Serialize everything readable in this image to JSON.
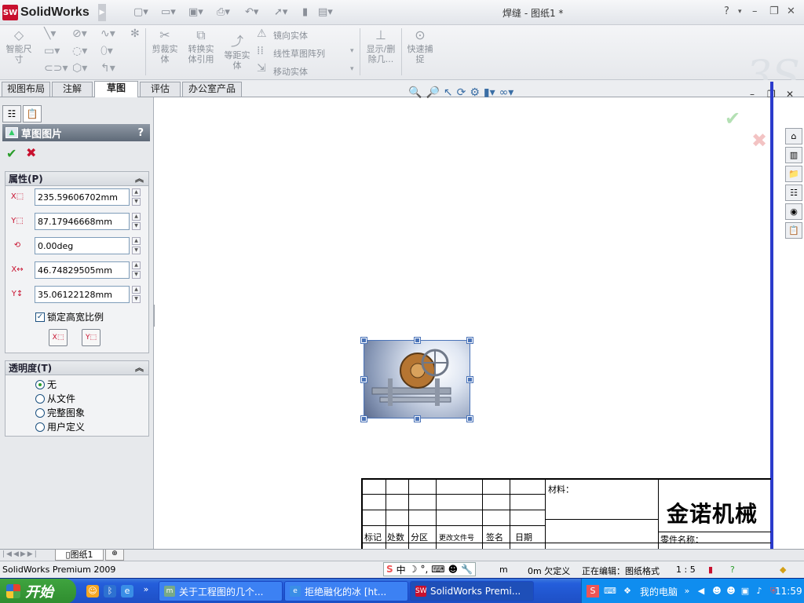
{
  "app": {
    "name_part1": "Solid",
    "name_part2": "Works",
    "logo_text": "SW"
  },
  "window": {
    "title": "焊缝 - 图纸1 *",
    "help": "?",
    "minimize": "–",
    "restore": "❐",
    "close": "✕"
  },
  "ribbon": {
    "smart_dim": "智能尺寸",
    "trim": "剪裁实体",
    "convert": "转换实体引用",
    "offset": "等距实体",
    "mirror": "镜向实体",
    "linear_pattern": "线性草图阵列",
    "move": "移动实体",
    "show_hide": "显示/删除几...",
    "quick_snap": "快速捕捉"
  },
  "tabs": [
    "视图布局",
    "注解",
    "草图",
    "评估",
    "办公室产品"
  ],
  "panel": {
    "title": "草图图片",
    "help": "?",
    "properties_title": "属性(P)",
    "fields": [
      {
        "value": "235.59606702mm"
      },
      {
        "value": "87.17946668mm"
      },
      {
        "value": "0.00deg"
      },
      {
        "value": "46.74829505mm"
      },
      {
        "value": "35.06122128mm"
      }
    ],
    "lock_ratio": "锁定高宽比例",
    "transparency_title": "透明度(T)",
    "transparency_options": [
      "无",
      "从文件",
      "完整图象",
      "用户定义"
    ],
    "transparency_selected": "无"
  },
  "titleblock": {
    "material_label": "材料：",
    "company": "金诺机械",
    "part_name_label": "零件名称：",
    "headers": [
      "标记",
      "处数",
      "分区",
      "更改文件号",
      "签名",
      "日期"
    ]
  },
  "sheet": {
    "tab": "图纸1"
  },
  "status": {
    "product": "SolidWorks Premium 2009",
    "unit_frag": "m",
    "constraint": "0m 欠定义",
    "editing": "正在编辑：图纸格式",
    "scale": "1 : 5"
  },
  "ime": {
    "logo": "S",
    "mode": "中"
  },
  "taskbar": {
    "start": "开始",
    "buttons": [
      "关于工程图的几个...",
      "拒绝融化的冰 [ht...",
      "SolidWorks Premi..."
    ],
    "tray_label": "我的电脑",
    "clock": "11:59"
  },
  "colors": {
    "accent_red": "#c8102e",
    "blue_line": "#2b3bcc",
    "taskbar": "#245edb",
    "start": "#2f8d2f"
  }
}
